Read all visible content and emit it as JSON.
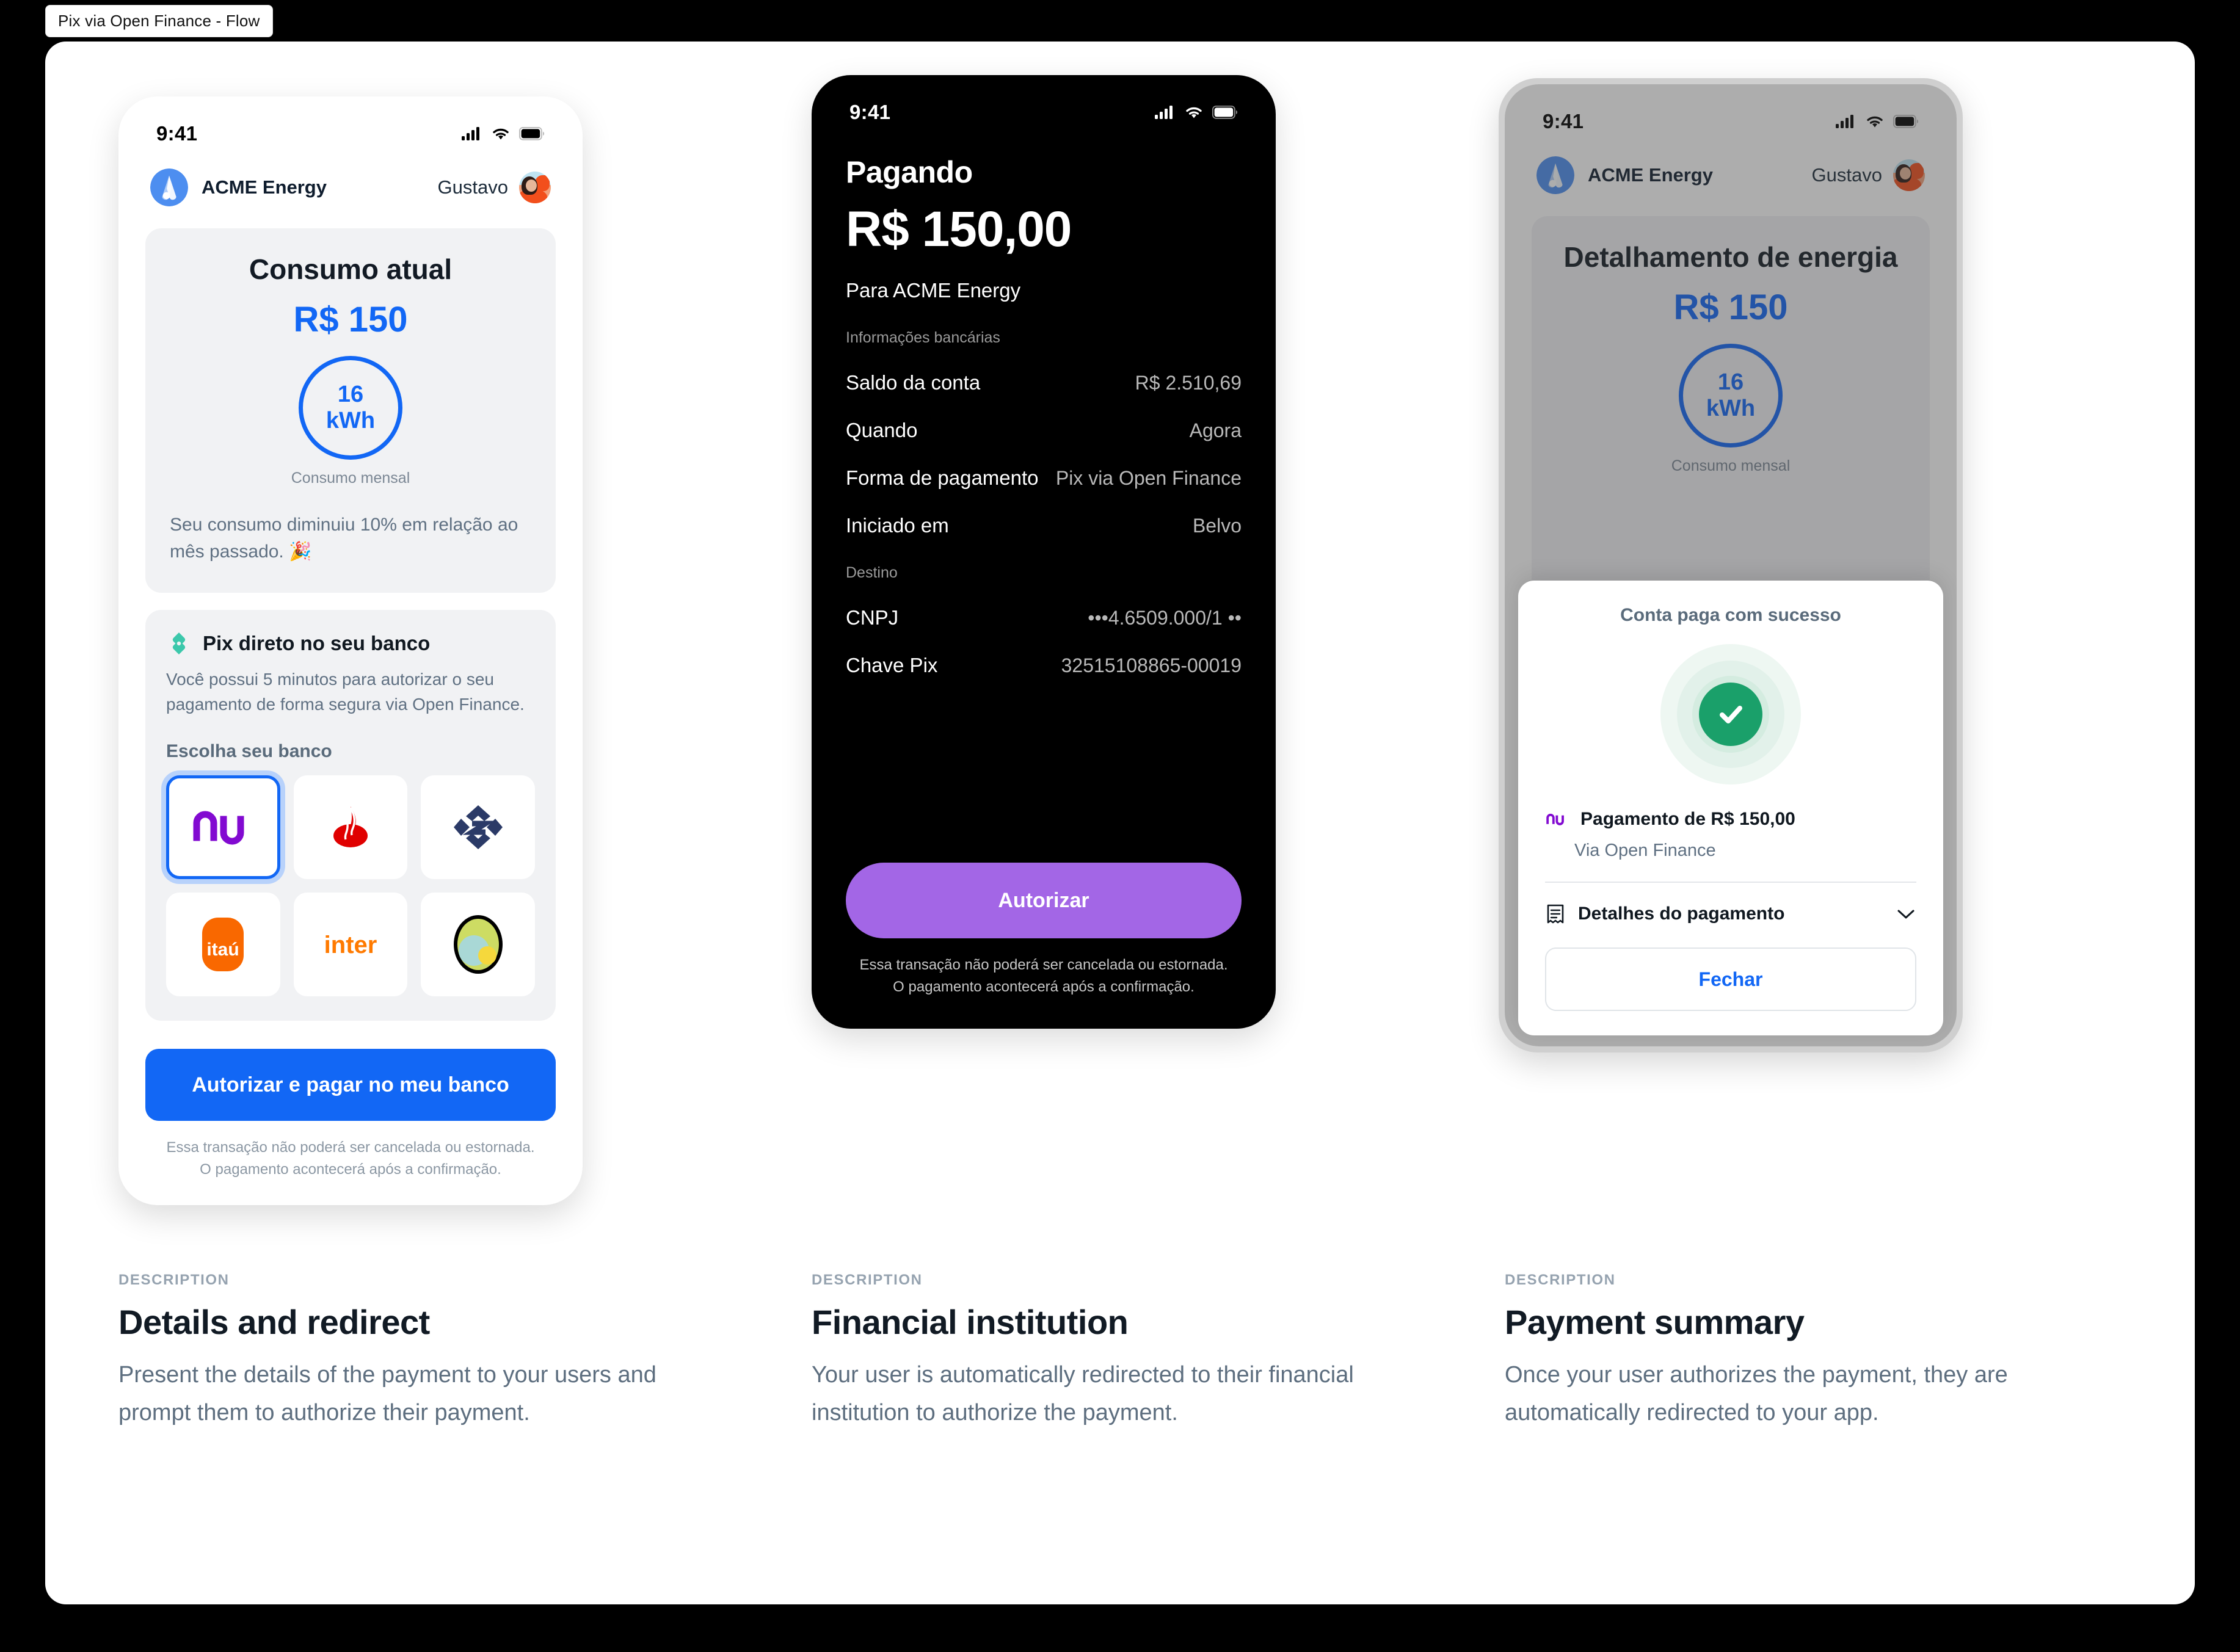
{
  "frame": {
    "tab_label": "Pix via Open Finance - Flow"
  },
  "phone1": {
    "status": {
      "time": "9:41",
      "icons": [
        "signal-icon",
        "wifi-icon",
        "battery-icon"
      ]
    },
    "header": {
      "brand": "ACME Energy",
      "user": "Gustavo",
      "logo_icon": "acme-logo-icon",
      "avatar_icon": "user-avatar"
    },
    "consumption_card": {
      "title": "Consumo atual",
      "amount": "R$ 150",
      "gauge_value": "16",
      "gauge_unit": "kWh",
      "gauge_caption": "Consumo mensal",
      "note": "Seu consumo diminuiu 10% em relação ao mês passado. 🎉"
    },
    "pix_card": {
      "icon": "pix-icon",
      "title": "Pix direto no seu banco",
      "subtitle": "Você possui 5 minutos para autorizar o seu pagamento de forma segura via Open Finance.",
      "choose_label": "Escolha seu banco",
      "banks": [
        {
          "name": "Nubank",
          "icon": "nubank-logo-icon",
          "selected": true
        },
        {
          "name": "Santander",
          "icon": "santander-logo-icon",
          "selected": false
        },
        {
          "name": "Banco do Brasil",
          "icon": "banco-do-brasil-logo-icon",
          "selected": false
        },
        {
          "name": "Itaú",
          "icon": "itau-logo-icon",
          "selected": false
        },
        {
          "name": "Inter",
          "icon": "inter-logo-icon",
          "selected": false
        },
        {
          "name": "Sicredi",
          "icon": "sicredi-logo-icon",
          "selected": false
        }
      ]
    },
    "cta_label": "Autorizar e pagar no meu banco",
    "legal_line1": "Essa transação não poderá ser cancelada ou estornada.",
    "legal_line2": "O pagamento acontecerá após a confirmação."
  },
  "phone2": {
    "status": {
      "time": "9:41"
    },
    "heading": "Pagando",
    "amount": "R$ 150,00",
    "payee": "Para ACME Energy",
    "section_bank": "Informações bancárias",
    "rows_bank": [
      {
        "label": "Saldo da conta",
        "value": "R$ 2.510,69"
      },
      {
        "label": "Quando",
        "value": "Agora"
      },
      {
        "label": "Forma de pagamento",
        "value": "Pix via Open Finance"
      },
      {
        "label": "Iniciado em",
        "value": "Belvo"
      }
    ],
    "section_dest": "Destino",
    "rows_dest": [
      {
        "label": "CNPJ",
        "value": "•••4.6509.000/1 ••"
      },
      {
        "label": "Chave Pix",
        "value": "32515108865-00019"
      }
    ],
    "cta_label": "Autorizar",
    "legal_line1": "Essa transação não poderá ser cancelada ou estornada.",
    "legal_line2": "O pagamento acontecerá após a confirmação."
  },
  "phone3": {
    "status": {
      "time": "9:41"
    },
    "header": {
      "brand": "ACME Energy",
      "user": "Gustavo"
    },
    "detail_card": {
      "title": "Detalhamento de energia",
      "amount": "R$ 150",
      "gauge_value": "16",
      "gauge_unit": "kWh",
      "gauge_caption": "Consumo mensal"
    },
    "sheet": {
      "title": "Conta paga com sucesso",
      "status_icon": "check-circle-icon",
      "bank_icon": "nubank-logo-icon",
      "payment_line": "Pagamento de R$ 150,00",
      "via_line": "Via Open Finance",
      "details_icon": "receipt-icon",
      "details_label": "Detalhes do pagamento",
      "chevron_icon": "chevron-down-icon",
      "close_label": "Fechar"
    }
  },
  "captions": [
    {
      "kicker": "DESCRIPTION",
      "title": "Details and redirect",
      "body": "Present the details of the payment to your users and prompt them to authorize their payment."
    },
    {
      "kicker": "DESCRIPTION",
      "title": "Financial institution",
      "body": "Your user is automatically redirected to their financial institution to authorize the payment."
    },
    {
      "kicker": "DESCRIPTION",
      "title": "Payment summary",
      "body": "Once your user authorizes the payment, they are automatically redirected to your app."
    }
  ],
  "colors": {
    "accent_blue": "#1267f5",
    "purple": "#a366e6",
    "success_green": "#1aa06a",
    "pix_teal": "#3cc8ab",
    "nubank_purple": "#820ad1"
  }
}
